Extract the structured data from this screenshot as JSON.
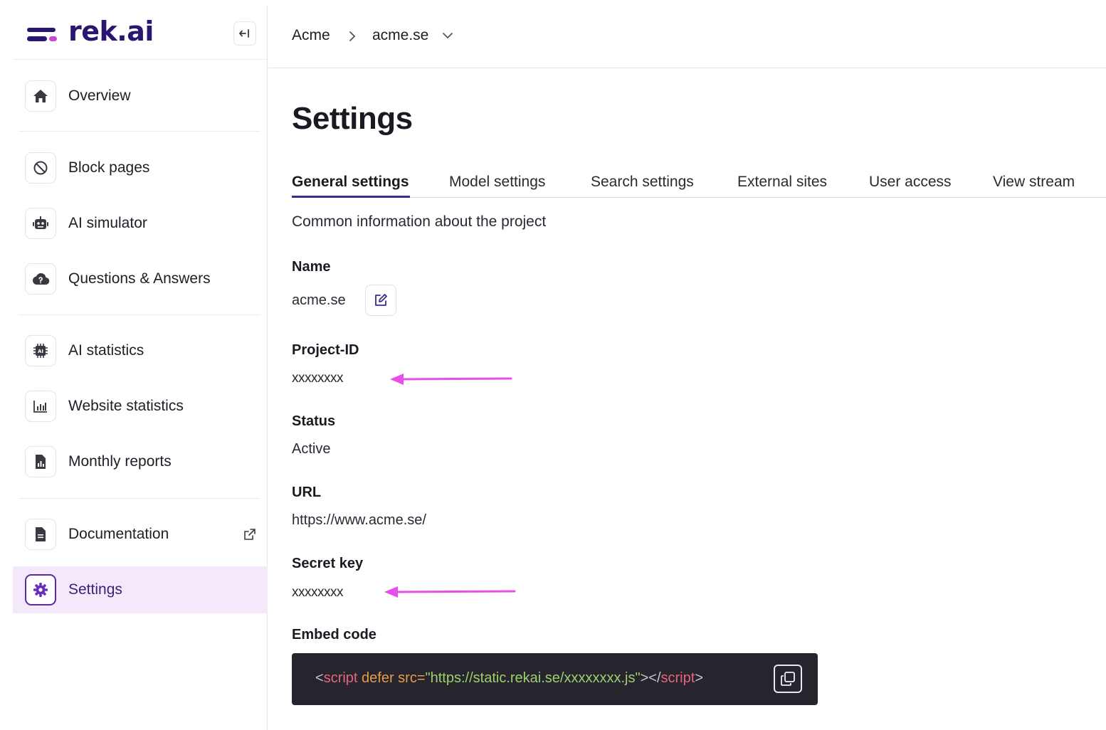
{
  "brand": {
    "name": "rek.ai"
  },
  "sidebar": {
    "items": [
      {
        "label": "Overview",
        "icon": "home-icon"
      },
      {
        "label": "Block pages",
        "icon": "block-icon"
      },
      {
        "label": "AI simulator",
        "icon": "robot-icon"
      },
      {
        "label": "Questions & Answers",
        "icon": "cloud-question-icon"
      },
      {
        "label": "AI statistics",
        "icon": "ai-chip-icon"
      },
      {
        "label": "Website statistics",
        "icon": "bar-chart-icon"
      },
      {
        "label": "Monthly reports",
        "icon": "report-file-icon"
      },
      {
        "label": "Documentation",
        "icon": "document-icon"
      },
      {
        "label": "Settings",
        "icon": "gear-icon",
        "active": true
      }
    ]
  },
  "breadcrumb": {
    "root": "Acme",
    "current": "acme.se"
  },
  "page": {
    "title": "Settings",
    "tabs": [
      {
        "label": "General settings",
        "active": true
      },
      {
        "label": "Model settings"
      },
      {
        "label": "Search settings"
      },
      {
        "label": "External sites"
      },
      {
        "label": "User access"
      },
      {
        "label": "View stream"
      }
    ],
    "subtitle": "Common information about the project"
  },
  "fields": {
    "name": {
      "label": "Name",
      "value": "acme.se"
    },
    "project_id": {
      "label": "Project-ID",
      "value": "xxxxxxxx"
    },
    "status": {
      "label": "Status",
      "value": "Active"
    },
    "url": {
      "label": "URL",
      "value": "https://www.acme.se/"
    },
    "secret_key": {
      "label": "Secret key",
      "value": "xxxxxxxx"
    },
    "embed_code": {
      "label": "Embed code",
      "parts": {
        "open_bracket": "<",
        "tag": "script",
        "attr": " defer src=",
        "src": "\"https://static.rekai.se/xxxxxxxx.js\"",
        "mid": "></",
        "close_tag": "script",
        "close_bracket": ">"
      }
    }
  },
  "colors": {
    "accent": "#3a2a8c",
    "active_bg": "#f3e9fb",
    "annotation_arrow": "#e84ee8",
    "code_bg": "#26252e"
  }
}
